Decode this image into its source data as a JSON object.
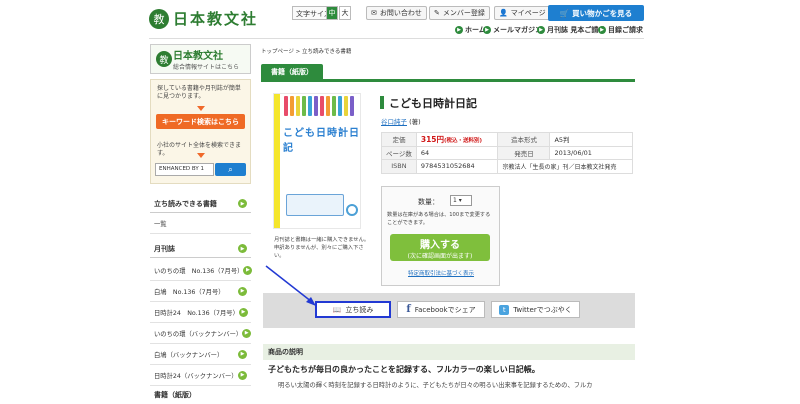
{
  "header": {
    "logo": "日本教文社",
    "font_size_label": "文字サイズ",
    "font_size_medium": "中",
    "font_size_large": "大",
    "contact": "お問い合わせ",
    "member_register": "メンバー登録",
    "mypage": "マイページ",
    "cart": "買い物かごを見る",
    "subnav": [
      "ホーム",
      "メールマガジン",
      "月刊誌 見本ご請求",
      "目録ご請求"
    ]
  },
  "sidebar": {
    "brand_name": "日本教文社",
    "brand_sub": "総合情報サイトはこちら",
    "search_text1": "探している書籍や月刊誌が簡単に見つかります。",
    "keyword_button": "キーワード検索はこちら",
    "search_text2": "小社のサイト全体を検索できます。",
    "search_input_value": "ENHANCED BY",
    "search_input_suffix": "1",
    "tachiyomi_title": "立ち読みできる書籍",
    "tachiyomi_item": "一覧",
    "magazine_title": "月刊誌",
    "magazine_items": [
      "いのちの環　No.136（7月号）",
      "白鳩　No.136（7月号）",
      "日時計24　No.136（7月号）",
      "いのちの環（バックナンバー）",
      "白鳩（バックナンバー）",
      "日時計24（バックナンバー）"
    ],
    "next_title": "書籍（紙版）"
  },
  "main": {
    "breadcrumb": "トップページ > 立ち読みできる書籍",
    "category_tab": "書籍（紙版）",
    "cover_title": "こども日時計日記",
    "cover_note": "月刊誌と書籍は一緒に購入できません。申訳ありませんが、別々にご購入下さい。",
    "title": "こども日時計日記",
    "author_name": "谷口純子",
    "author_suffix": "(著)",
    "info": {
      "price_label": "定価",
      "price": "315円",
      "price_note": "(税込・送料別)",
      "format_label": "造本形式",
      "format": "A5判",
      "pages_label": "ページ数",
      "pages": "64",
      "date_label": "発売日",
      "date": "2013/06/01",
      "isbn_label": "ISBN",
      "isbn": "9784531052684",
      "publisher": "宗教法人「生長の家」刊／日本教文社発売"
    },
    "quantity_label": "数量：",
    "quantity_value": "1",
    "order_note": "数量は在庫がある場合は、100まで変更することができます。",
    "buy_label": "購入する",
    "buy_sub": "(次に確認画面が出ます)",
    "trade_link": "特定商取引法に基づく表示",
    "share": {
      "tachiyomi": "立ち読み",
      "facebook": "Facebookでシェア",
      "twitter": "Twitterでつぶやく"
    },
    "desc_header": "商品の説明",
    "desc_title": "子どもたちが毎日の良かったことを記録する、フルカラーの楽しい日記帳。",
    "desc_body": "明るい太陽の輝く時刻を記録する日時計のように、子どもたちが日々の明るい出来事を記録するための、フルカ"
  },
  "colors": {
    "brand_green": "#2e8b3d",
    "cart_blue": "#1e7fd0",
    "keyword_orange": "#ef6a25",
    "buy_green": "#7fbf3c",
    "highlight_blue": "#2239d3"
  }
}
